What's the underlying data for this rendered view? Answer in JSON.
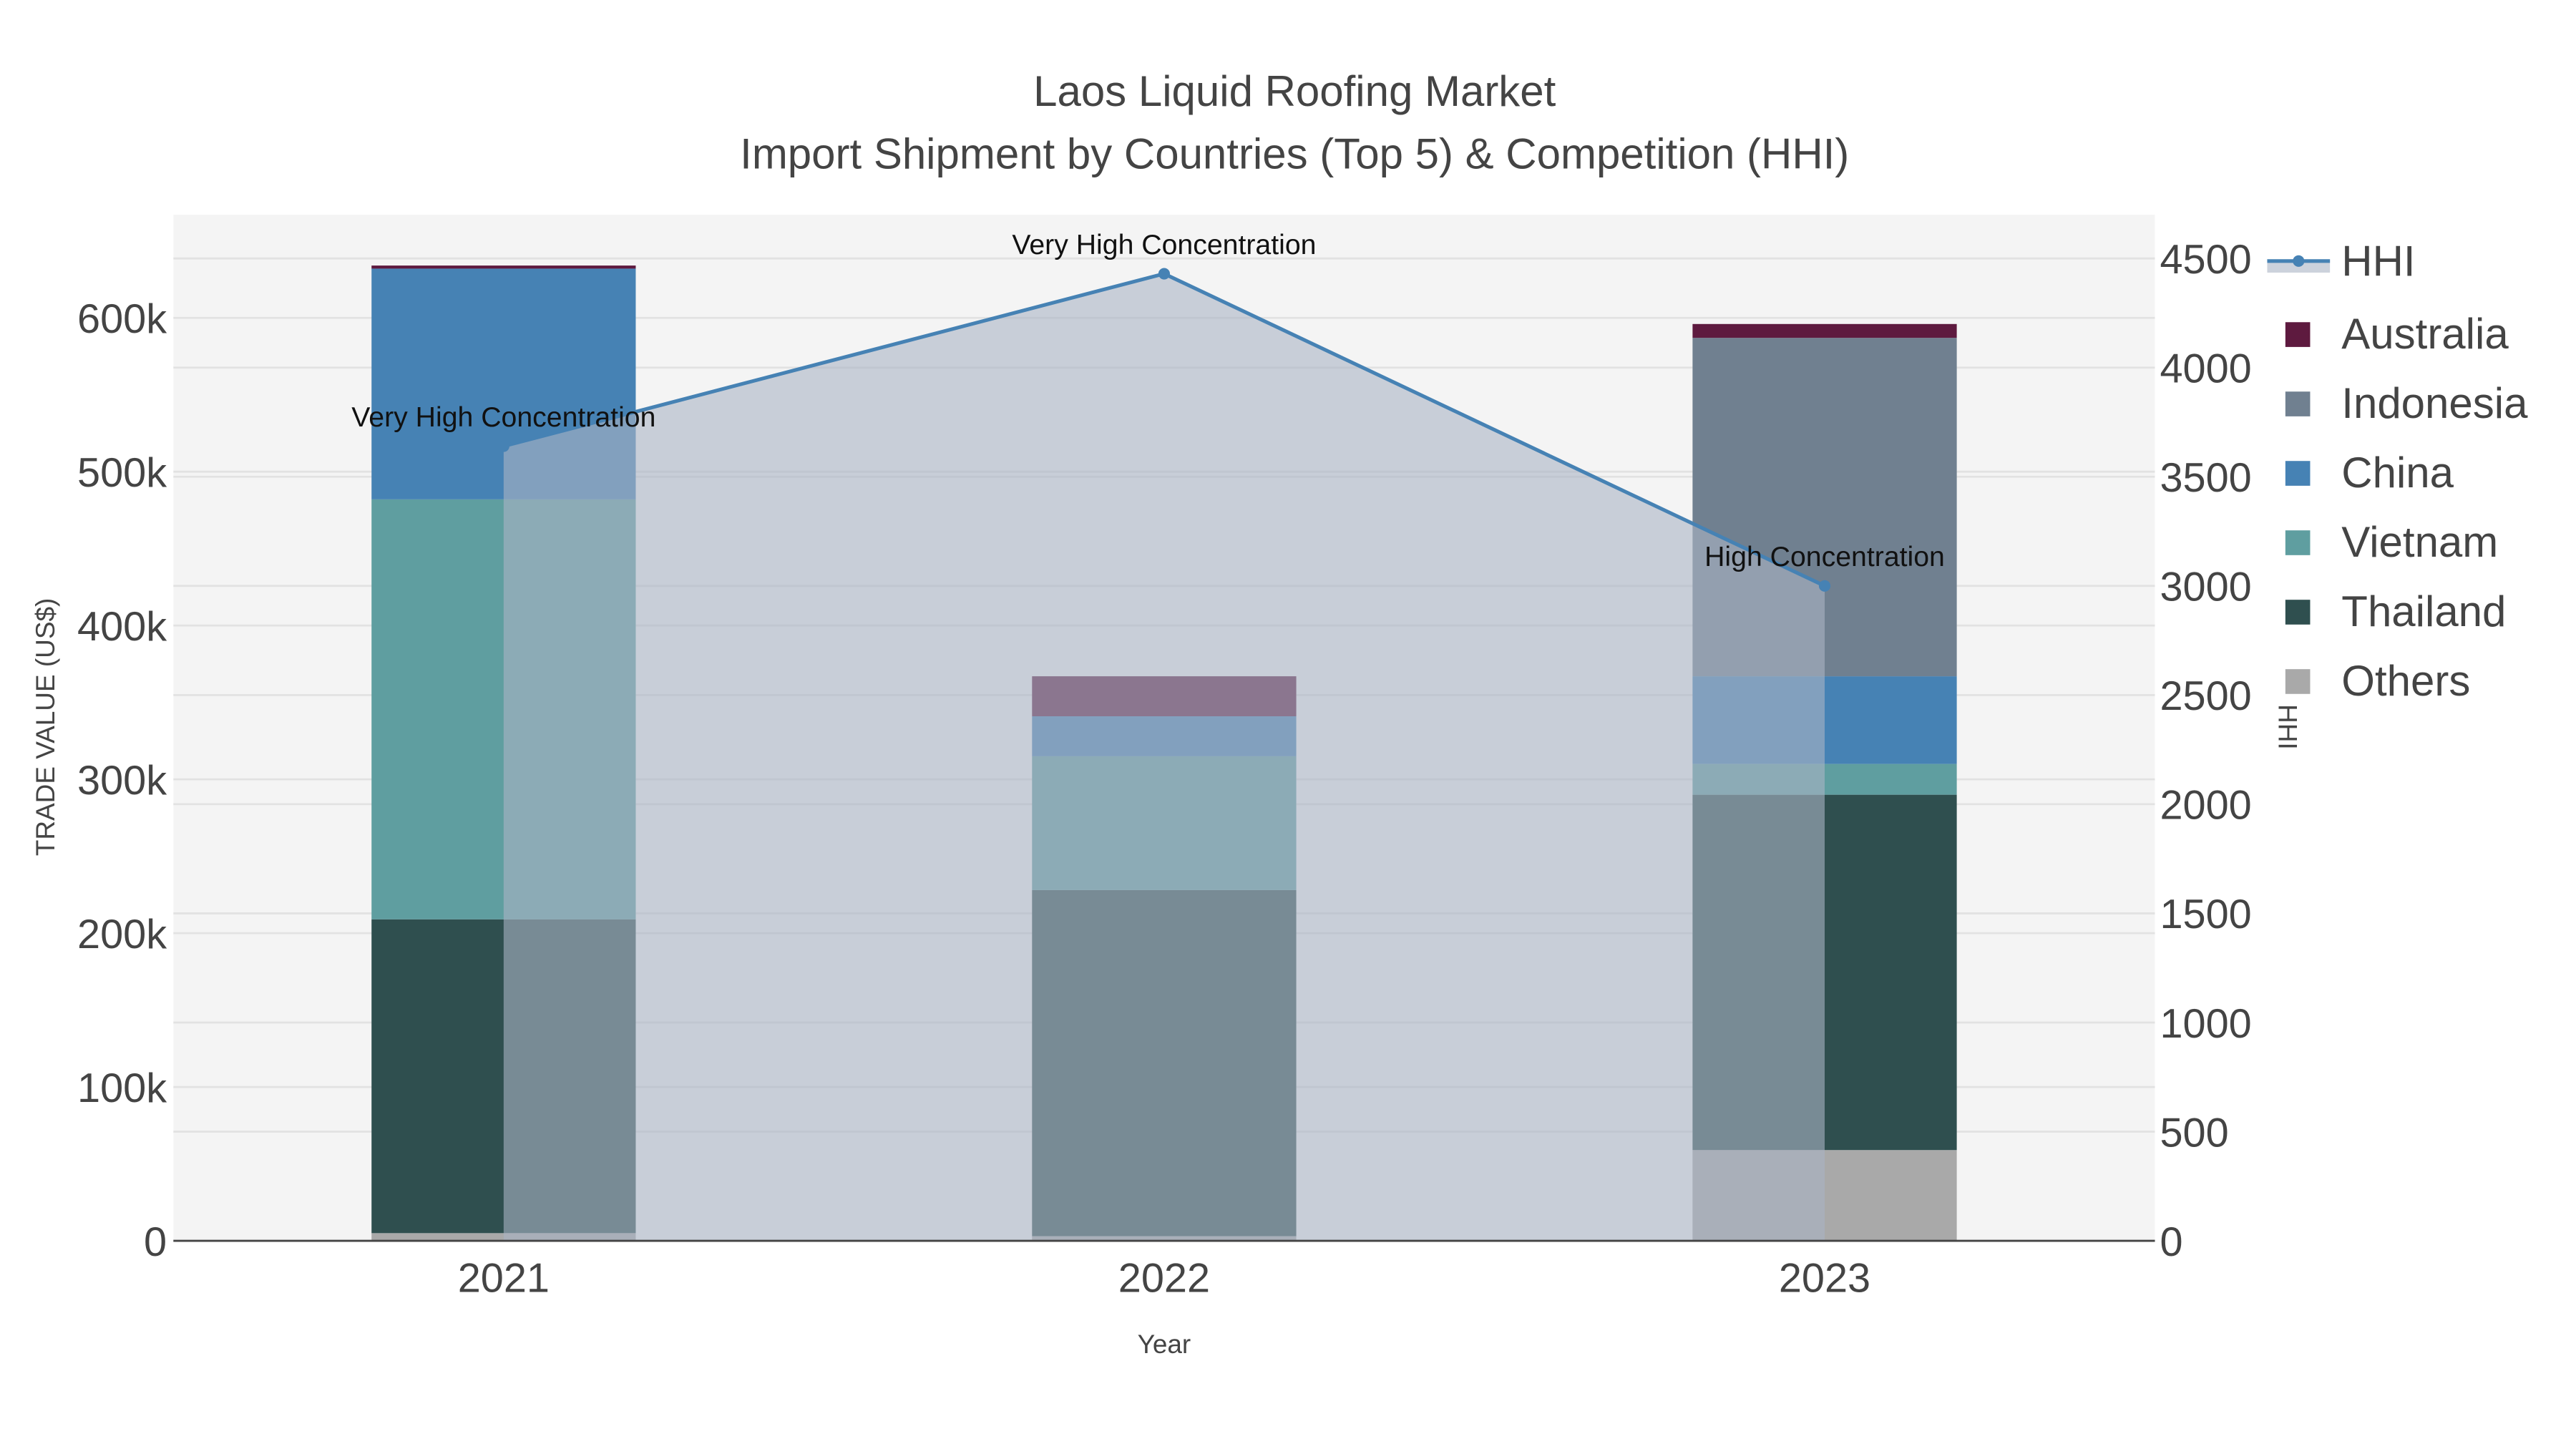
{
  "chart_data": {
    "type": "bar",
    "title_line1": "Laos Liquid Roofing Market",
    "title_line2": "Import Shipment by Countries (Top 5) & Competition (HHI)",
    "xlabel": "Year",
    "ylabel": "TRADE VALUE (US$)",
    "y2label": "HHI",
    "categories": [
      "2021",
      "2022",
      "2023"
    ],
    "ylim": [
      0,
      667000
    ],
    "y2lim": [
      0,
      4700
    ],
    "yticks": [
      0,
      100000,
      200000,
      300000,
      400000,
      500000,
      600000
    ],
    "ytick_labels": [
      "0",
      "100k",
      "200k",
      "300k",
      "400k",
      "500k",
      "600k"
    ],
    "y2ticks": [
      0,
      500,
      1000,
      1500,
      2000,
      2500,
      3000,
      3500,
      4000,
      4500
    ],
    "y2tick_labels": [
      "0",
      "500",
      "1000",
      "1500",
      "2000",
      "2500",
      "3000",
      "3500",
      "4000",
      "4500"
    ],
    "grid": true,
    "barmode": "stack",
    "series": [
      {
        "name": "Others",
        "color": "#a9a9a9",
        "values": [
          5000,
          3000,
          59000
        ]
      },
      {
        "name": "Thailand",
        "color": "#2f4f4f",
        "values": [
          204000,
          225000,
          231000
        ]
      },
      {
        "name": "Vietnam",
        "color": "#5f9ea0",
        "values": [
          273000,
          87000,
          20000
        ]
      },
      {
        "name": "China",
        "color": "#4682b4",
        "values": [
          150000,
          26000,
          57000
        ]
      },
      {
        "name": "Indonesia",
        "color": "#708090",
        "values": [
          0,
          0,
          220000
        ]
      },
      {
        "name": "Australia",
        "color": "#5e1a3f",
        "values": [
          2000,
          26000,
          9000
        ]
      }
    ],
    "hhi": {
      "name": "HHI",
      "color": "#4682b4",
      "values": [
        3640,
        4430,
        3000
      ],
      "annotations": [
        "Very High Concentration",
        "Very High Concentration",
        "High Concentration"
      ]
    },
    "legend_order": [
      "HHI",
      "Australia",
      "Indonesia",
      "China",
      "Vietnam",
      "Thailand",
      "Others"
    ],
    "legend_placement": "right"
  }
}
